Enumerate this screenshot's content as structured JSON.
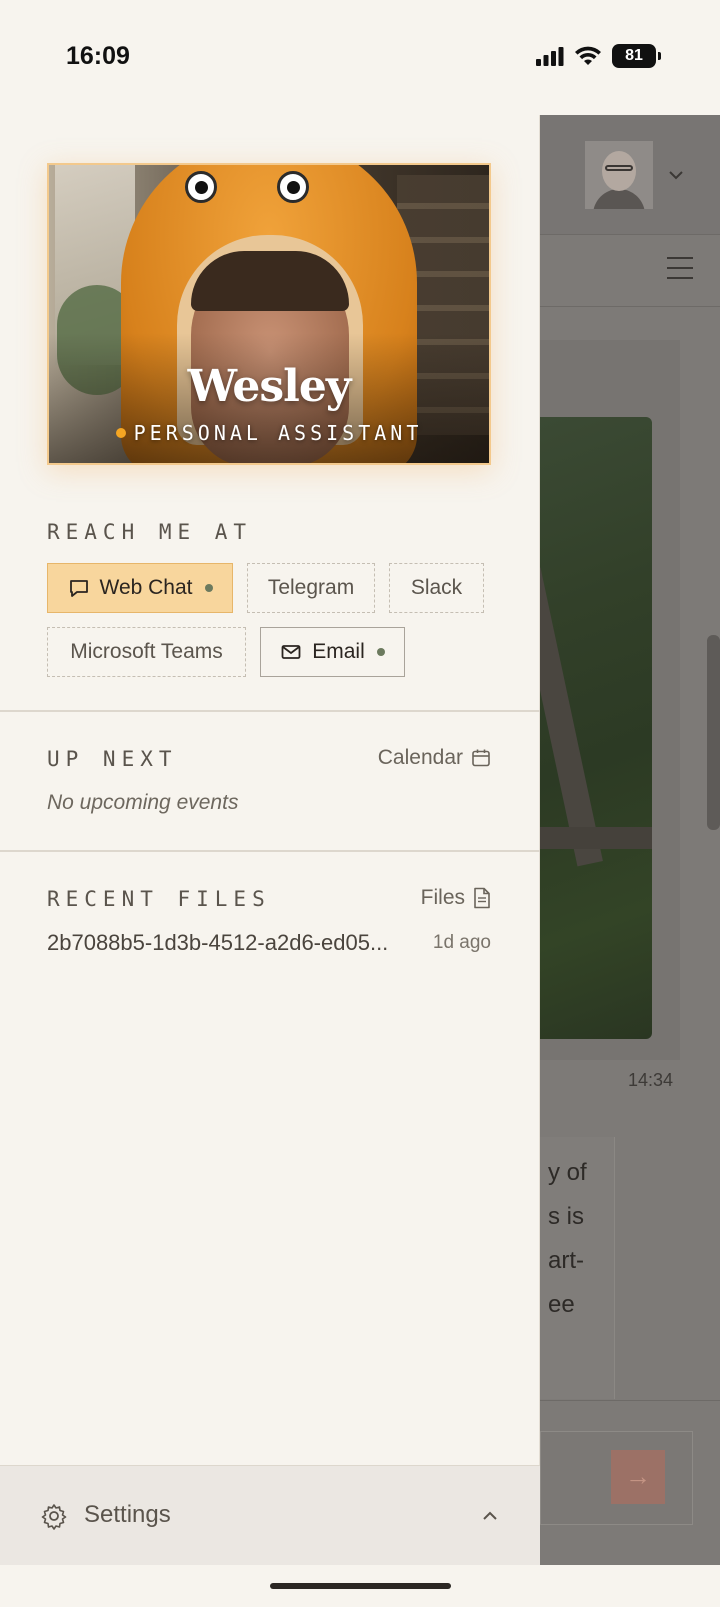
{
  "status_bar": {
    "time": "16:09",
    "battery": "81"
  },
  "assistant": {
    "name": "Wesley",
    "role": "PERSONAL ASSISTANT"
  },
  "reach": {
    "label": "REACH ME AT",
    "channels": [
      {
        "label": "Web Chat",
        "active": true,
        "online": true,
        "icon": "chat-bubble-icon"
      },
      {
        "label": "Telegram",
        "active": false,
        "online": false
      },
      {
        "label": "Slack",
        "active": false,
        "online": false
      },
      {
        "label": "Microsoft Teams",
        "active": false,
        "online": false
      },
      {
        "label": "Email",
        "active": false,
        "online": true,
        "icon": "mail-icon"
      }
    ]
  },
  "up_next": {
    "label": "UP NEXT",
    "link": "Calendar",
    "link_icon": "calendar-icon",
    "empty": "No upcoming events"
  },
  "recent_files": {
    "label": "RECENT FILES",
    "link": "Files",
    "link_icon": "file-icon",
    "items": [
      {
        "name": "2b7088b5-1d3b-4512-a2d6-ed05...",
        "age": "1d ago"
      }
    ]
  },
  "settings": {
    "label": "Settings"
  },
  "background_chat": {
    "message_time": "14:34",
    "message_fragments": [
      "y of",
      "s is",
      "art-",
      "ee"
    ],
    "send_icon": "arrow-right-icon"
  },
  "colors": {
    "accent": "#f8d69d",
    "accent_border": "#e7b66a",
    "background": "#f7f4ee",
    "online_dot": "#6c7a5e",
    "role_dot": "#f5a623"
  }
}
